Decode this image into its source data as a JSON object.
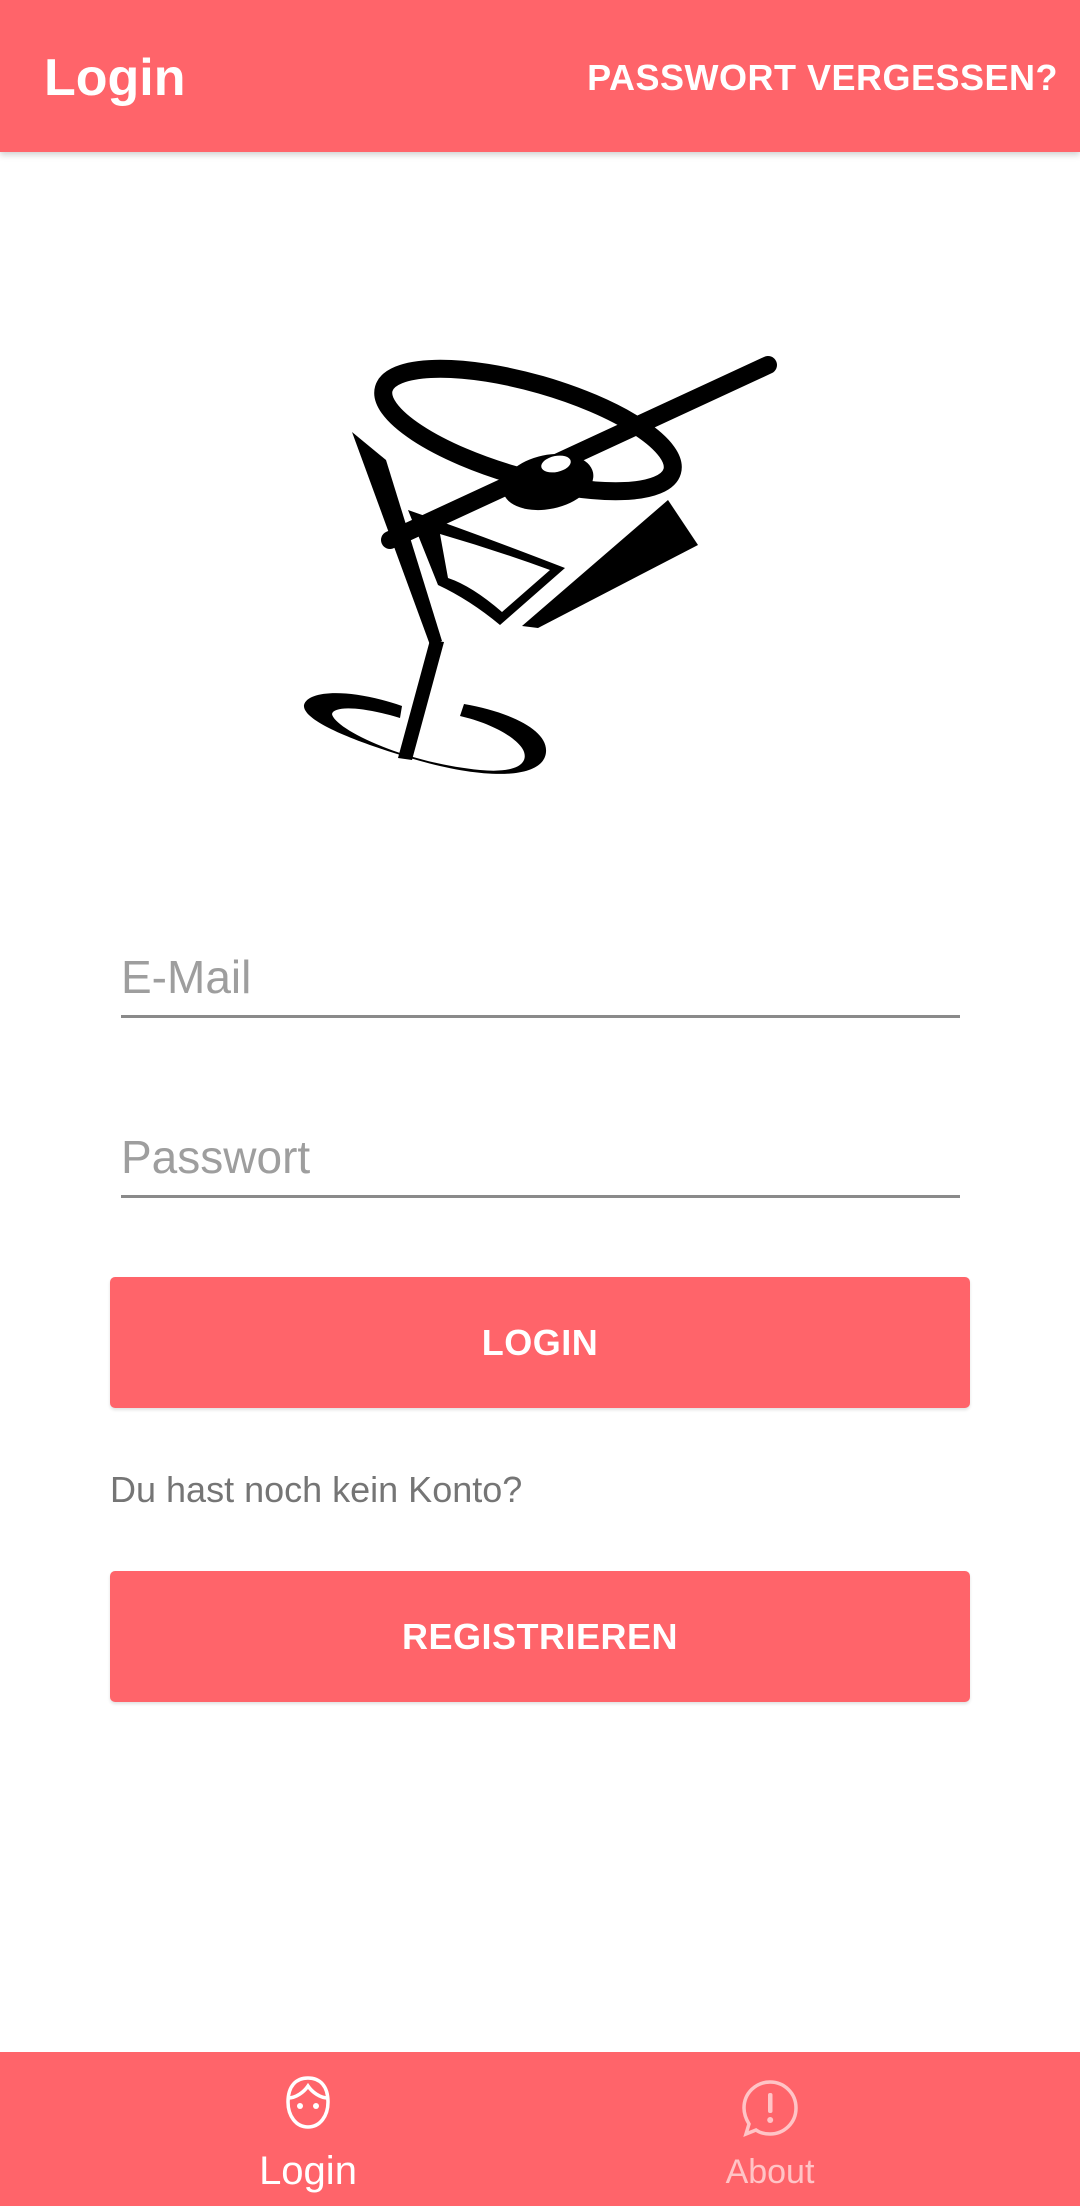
{
  "app_bar": {
    "title": "Login",
    "forgot_password": "PASSWORT VERGESSEN?"
  },
  "logo": {
    "icon": "martini-glass-logo"
  },
  "form": {
    "email_placeholder": "E-Mail",
    "email_value": "",
    "password_placeholder": "Passwort",
    "password_value": "",
    "login_button": "LOGIN",
    "no_account_text": "Du hast noch kein Konto?",
    "register_button": "REGISTRIEREN"
  },
  "bottom_nav": {
    "items": [
      {
        "label": "Login",
        "icon": "user-face-icon",
        "active": true
      },
      {
        "label": "About",
        "icon": "info-bubble-icon",
        "active": false
      }
    ]
  },
  "colors": {
    "accent": "#FF646A",
    "text_on_accent": "#FFFFFF",
    "muted_text": "#757575",
    "placeholder": "#9E9E9E"
  }
}
